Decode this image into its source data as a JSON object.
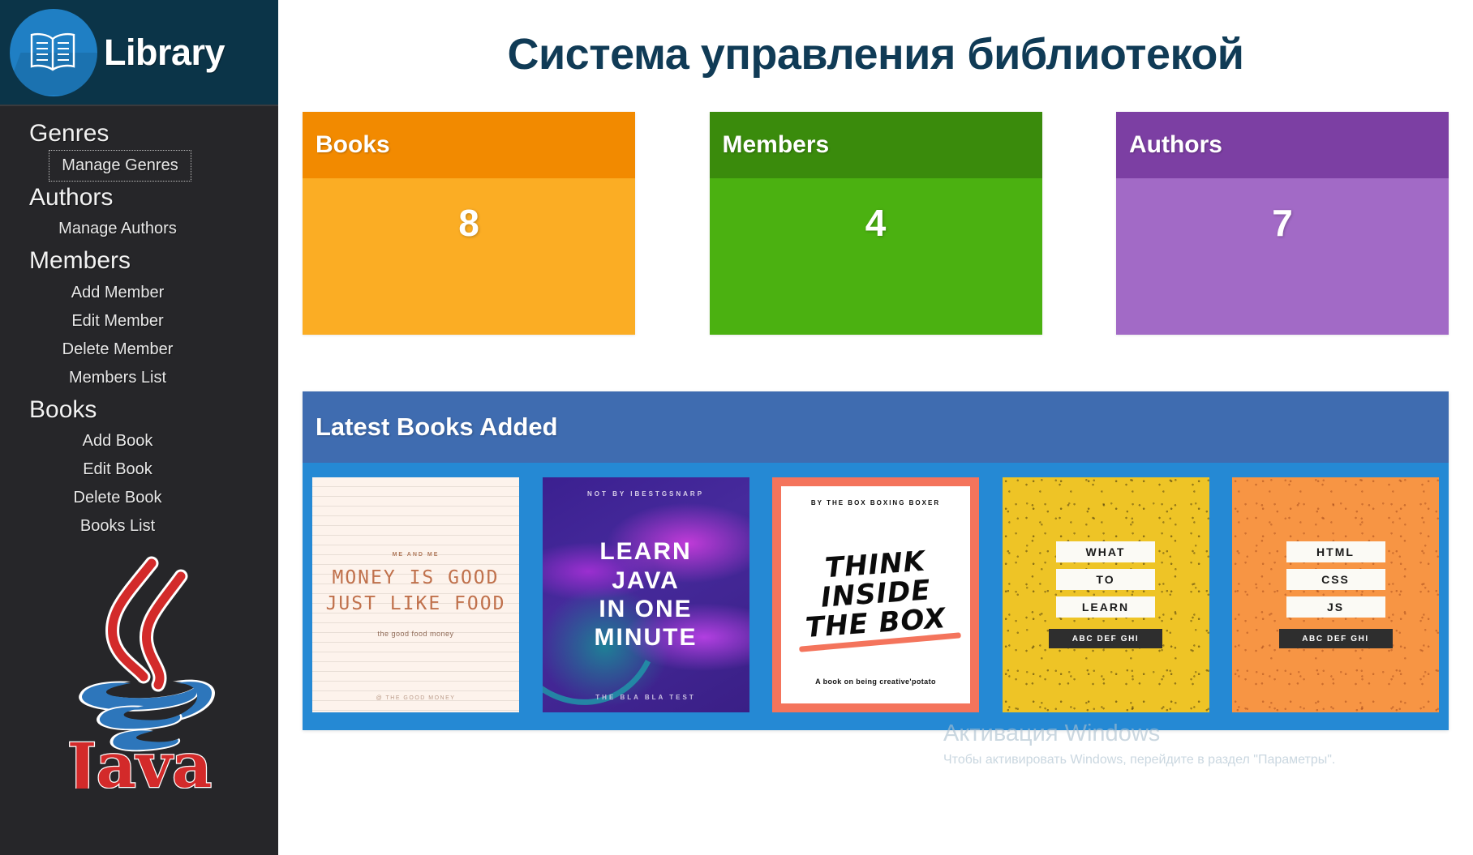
{
  "sidebar": {
    "brand": {
      "title": "Library",
      "logo_icon": "open-book-icon"
    },
    "nav": [
      {
        "type": "section",
        "label": "Genres"
      },
      {
        "type": "item",
        "label": "Manage Genres",
        "focused": true
      },
      {
        "type": "section",
        "label": "Authors"
      },
      {
        "type": "item",
        "label": "Manage Authors",
        "focused": false
      },
      {
        "type": "section",
        "label": "Members"
      },
      {
        "type": "item",
        "label": "Add Member",
        "focused": false
      },
      {
        "type": "item",
        "label": "Edit Member",
        "focused": false
      },
      {
        "type": "item",
        "label": "Delete Member",
        "focused": false
      },
      {
        "type": "item",
        "label": "Members List",
        "focused": false
      },
      {
        "type": "section",
        "label": "Books"
      },
      {
        "type": "item",
        "label": "Add Book",
        "focused": false
      },
      {
        "type": "item",
        "label": "Edit Book",
        "focused": false
      },
      {
        "type": "item",
        "label": "Delete Book",
        "focused": false
      },
      {
        "type": "item",
        "label": "Books List",
        "focused": false
      }
    ],
    "footer_logo": {
      "icon": "java-logo-icon",
      "wordmark": "Java",
      "trademark": "™"
    }
  },
  "header": {
    "title": "Система управления библиотекой"
  },
  "stat_cards": [
    {
      "title": "Books",
      "value": "8",
      "header_color": "#F28A00",
      "body_color": "#FBAD24"
    },
    {
      "title": "Members",
      "value": "4",
      "header_color": "#3A8B0C",
      "body_color": "#4BB111"
    },
    {
      "title": "Authors",
      "value": "7",
      "header_color": "#7C3FA3",
      "body_color": "#A26AC6"
    }
  ],
  "latest_panel": {
    "title": "Latest Books Added",
    "header_color": "#3F6CB0",
    "body_color": "#2589D4",
    "covers": [
      {
        "style": "money",
        "top_text": "ME AND ME",
        "line1": "MONEY IS GOOD",
        "line2": "JUST LIKE FOOD",
        "caption": "the good food money",
        "bottom_text": "@ THE GOOD MONEY"
      },
      {
        "style": "java",
        "top_text": "NOT BY IBESTGSNARP",
        "line1": "LEARN",
        "line2": "JAVA",
        "line3": "IN ONE",
        "line4": "MINUTE",
        "bottom_text": "THE BLA BLA TEST"
      },
      {
        "style": "box",
        "top_text": "BY THE BOX BOXING BOXER",
        "line1": "THINK",
        "line2": "INSIDE",
        "line3": "THE BOX",
        "bottom_text": "A book on being creative'potato"
      },
      {
        "style": "yellow",
        "labels": [
          "WHAT",
          "TO",
          "LEARN"
        ],
        "dark_label": "ABC DEF GHI"
      },
      {
        "style": "orange",
        "labels": [
          "HTML",
          "CSS",
          "JS"
        ],
        "dark_label": "ABC DEF GHI"
      }
    ]
  },
  "watermark": {
    "line1": "Активация Windows",
    "line2": "Чтобы активировать Windows, перейдите в раздел \"Параметры\"."
  }
}
